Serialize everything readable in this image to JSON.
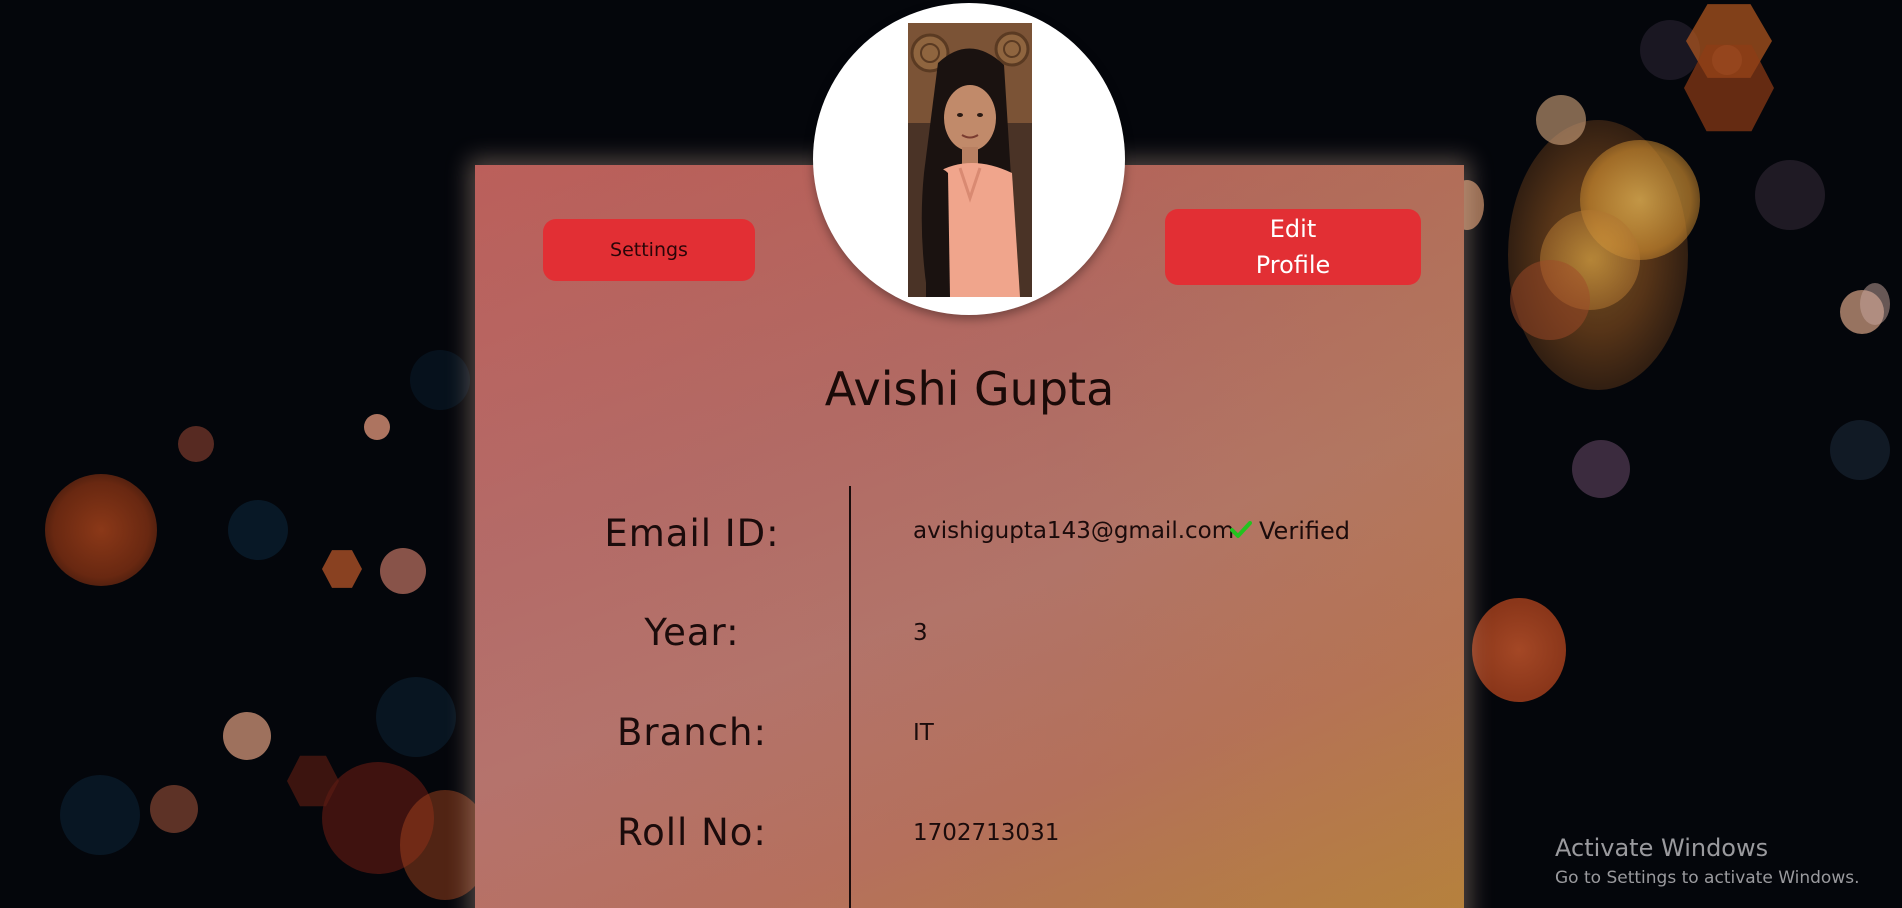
{
  "profile": {
    "name": "Avishi Gupta"
  },
  "buttons": {
    "settings_label": "Settings",
    "edit_profile_label": "Edit\nProfile"
  },
  "fields": {
    "email": {
      "label": "Email ID:",
      "value": "avishigupta143@gmail.com"
    },
    "year": {
      "label": "Year:",
      "value": "3"
    },
    "branch": {
      "label": "Branch:",
      "value": "IT"
    },
    "roll": {
      "label": "Roll No:",
      "value": "1702713031"
    }
  },
  "verification": {
    "status_text": "Verified",
    "icon": "check-icon",
    "icon_color": "#22c31f"
  },
  "watermark": {
    "title": "Activate Windows",
    "subtitle": "Go to Settings to activate Windows."
  },
  "colors": {
    "button": "#e22f34",
    "background": "#04060b"
  }
}
